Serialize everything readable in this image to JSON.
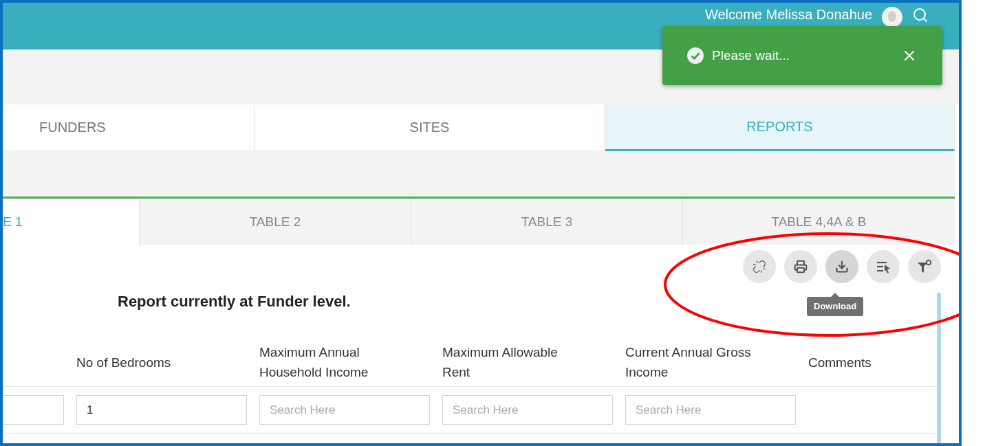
{
  "header": {
    "welcome": "Welcome Melissa Donahue"
  },
  "toast": {
    "message": "Please wait..."
  },
  "main_tabs": [
    {
      "label": "FUNDERS",
      "selected": false
    },
    {
      "label": "SITES",
      "selected": false
    },
    {
      "label": "REPORTS",
      "selected": true
    }
  ],
  "sub_tabs": [
    {
      "label": "E 1",
      "selected": true
    },
    {
      "label": "TABLE 2",
      "selected": false
    },
    {
      "label": "TABLE 3",
      "selected": false
    },
    {
      "label": "TABLE 4,4A & B",
      "selected": false
    }
  ],
  "toolbar": {
    "buttons": [
      {
        "kind": "unlink",
        "hovered": false
      },
      {
        "kind": "print",
        "hovered": false
      },
      {
        "kind": "download",
        "hovered": true
      },
      {
        "kind": "columns",
        "hovered": false
      },
      {
        "kind": "filter",
        "hovered": false
      }
    ],
    "tooltip": "Download"
  },
  "report_heading": "Report currently at Funder level.",
  "table": {
    "columns": [
      {
        "label": "No of Bedrooms"
      },
      {
        "label": "Maximum Annual Household Income"
      },
      {
        "label": "Maximum Allowable Rent"
      },
      {
        "label": "Current Annual Gross Income"
      },
      {
        "label": "Comments"
      }
    ],
    "filters": [
      {
        "kind": "cut"
      },
      {
        "kind": "full",
        "value": "1"
      },
      {
        "kind": "full",
        "placeholder": "Search Here"
      },
      {
        "kind": "full",
        "placeholder": "Search Here"
      },
      {
        "kind": "full",
        "placeholder": "Search Here"
      }
    ]
  }
}
